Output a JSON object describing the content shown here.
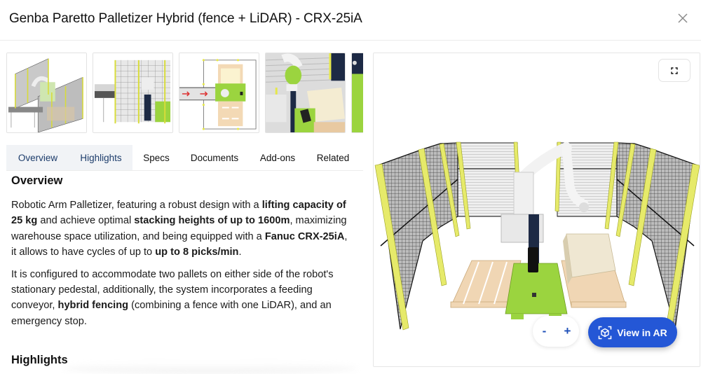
{
  "header": {
    "title": "Genba Paretto Palletizer Hybrid (fence + LiDAR) - CRX-25iA",
    "close_icon": "close-icon"
  },
  "thumbnails": [
    {
      "name": "isometric-overview",
      "alt": "Isometric view of fenced palletizer cell with conveyor"
    },
    {
      "name": "side-view",
      "alt": "Side view of fenced cell with conveyor"
    },
    {
      "name": "top-view",
      "alt": "Top-down layout view with conveyor arrows"
    },
    {
      "name": "closeup-robot",
      "alt": "Close-up of robot arm, tablet and box"
    },
    {
      "name": "partial-thumbnail",
      "alt": "Partially visible thumbnail"
    }
  ],
  "tabs": [
    {
      "label": "Overview",
      "active": true
    },
    {
      "label": "Highlights",
      "active": true
    },
    {
      "label": "Specs",
      "active": false
    },
    {
      "label": "Documents",
      "active": false
    },
    {
      "label": "Add-ons",
      "active": false
    },
    {
      "label": "Related",
      "active": false
    }
  ],
  "overview": {
    "heading": "Overview",
    "p1": {
      "t1": "Robotic Arm Palletizer, featuring a robust design with a ",
      "b1": "lifting capacity of 25 kg",
      "t2": " and achieve optimal ",
      "b2": "stacking heights of up to 1600m",
      "t3": ", maximizing warehouse space utilization, and being equipped with a ",
      "b3": "Fanuc CRX-25iA",
      "t4": ", it allows to have cycles of up to ",
      "b4": "up to 8 picks/min",
      "t5": "."
    },
    "p2": {
      "t1": "It is configured to accommodate two pallets on either side of the robot's stationary pedestal, additionally, the system incorporates a feeding conveyor, ",
      "b1": "hybrid fencing",
      "t2": " (combining a fence with one LiDAR), and an emergency stop."
    }
  },
  "highlights": {
    "heading": "Highlights"
  },
  "viewer": {
    "fullscreen_icon": "fullscreen-icon",
    "zoom_out_label": "-",
    "zoom_in_label": "+",
    "ar_button_label": "View in AR",
    "ar_icon": "ar-cube-icon",
    "colors": {
      "accent": "#2457d6",
      "fence_post": "#e6ea6a",
      "robot_base": "#9bd43f",
      "pallet": "#f0d6b4",
      "box": "#efe7d2"
    }
  }
}
